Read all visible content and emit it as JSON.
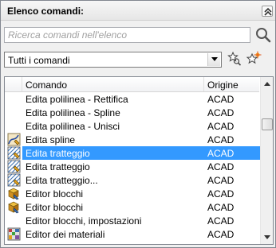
{
  "panel": {
    "title": "Elenco comandi:"
  },
  "search": {
    "placeholder": "Ricerca comandi nell'elenco"
  },
  "filter": {
    "selected": "Tutti i comandi"
  },
  "table": {
    "columns": [
      "Comando",
      "Origine"
    ],
    "rows": [
      {
        "command": "Edita polilinea - Rettifica",
        "origin": "ACAD",
        "icon": "none"
      },
      {
        "command": "Edita polilinea - Spline",
        "origin": "ACAD",
        "icon": "none"
      },
      {
        "command": "Edita polilinea - Unisci",
        "origin": "ACAD",
        "icon": "none"
      },
      {
        "command": "Edita spline",
        "origin": "ACAD",
        "icon": "edit-spline-icon"
      },
      {
        "command": "Edita tratteggio",
        "origin": "ACAD",
        "icon": "edit-hatch-icon",
        "selected": true
      },
      {
        "command": "Edita tratteggio",
        "origin": "ACAD",
        "icon": "edit-hatch-icon"
      },
      {
        "command": "Edita tratteggio...",
        "origin": "ACAD",
        "icon": "edit-hatch-icon"
      },
      {
        "command": "Editor blocchi",
        "origin": "ACAD",
        "icon": "block-editor-icon"
      },
      {
        "command": "Editor blocchi",
        "origin": "ACAD",
        "icon": "block-editor-icon"
      },
      {
        "command": "Editor blocchi, impostazioni",
        "origin": "ACAD",
        "icon": "none"
      },
      {
        "command": "Editor dei materiali",
        "origin": "ACAD",
        "icon": "materials-editor-icon"
      }
    ]
  },
  "colors": {
    "selection": "#3399ff",
    "border": "#828790"
  }
}
